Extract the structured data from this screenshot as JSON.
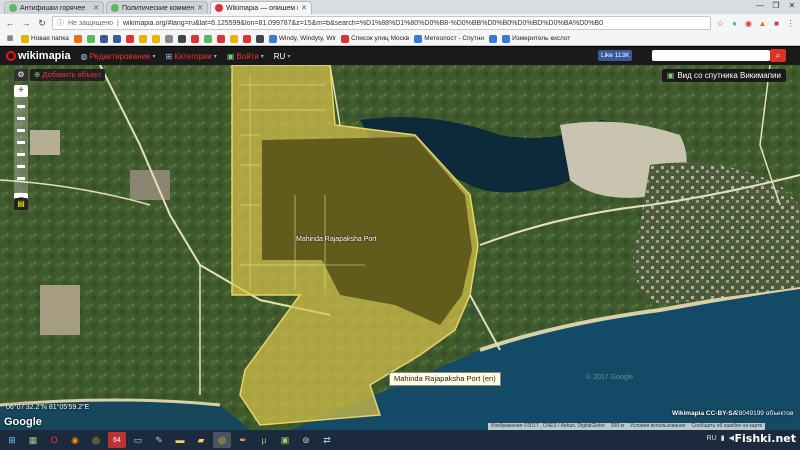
{
  "browser": {
    "tabs": [
      {
        "title": "Антифишки горячее",
        "favicon_color": "#5cb85c"
      },
      {
        "title": "Политические коммента",
        "favicon_color": "#5cb85c"
      },
      {
        "title": "Wikimapia — опишем в",
        "favicon_color": "#d33"
      }
    ],
    "security_label": "Не защищено",
    "url": "wikimapia.org/#lang=ru&lat=6.125599&lon=81.099787&z=15&m=b&search=%D1%88%D1%80%D0%B8-%D0%BB%D0%B0%D0%BD%D0%BA%D0%B0",
    "bookmarks": [
      {
        "label": "Новая папка",
        "color": "#e8b400"
      },
      {
        "label": "",
        "color": "#e96d0c"
      },
      {
        "label": "",
        "color": "#5cb85c"
      },
      {
        "label": "",
        "color": "#3b5998"
      },
      {
        "label": "",
        "color": "#3b5998"
      },
      {
        "label": "",
        "color": "#d33"
      },
      {
        "label": "",
        "color": "#e8b400"
      },
      {
        "label": "",
        "color": "#e8b400"
      },
      {
        "label": "",
        "color": "#888"
      },
      {
        "label": "",
        "color": "#444"
      },
      {
        "label": "",
        "color": "#d33"
      },
      {
        "label": "",
        "color": "#5cb85c"
      },
      {
        "label": "",
        "color": "#d33"
      },
      {
        "label": "",
        "color": "#e8b400"
      },
      {
        "label": "",
        "color": "#d33"
      },
      {
        "label": "",
        "color": "#444"
      },
      {
        "label": "Windy, Windyty, Wir",
        "color": "#3c78d8"
      },
      {
        "label": "Список улиц Москв",
        "color": "#d33"
      },
      {
        "label": "Метеопост - Спутни",
        "color": "#3c78d8"
      },
      {
        "label": "",
        "color": "#3c78d8"
      },
      {
        "label": "Измеритель кислот",
        "color": "#3c78d8"
      }
    ]
  },
  "header": {
    "logo": "wikimapia",
    "nav": [
      {
        "label": "Редактирование",
        "icon": "globe-icon"
      },
      {
        "label": "Категории",
        "icon": "tree-icon"
      },
      {
        "label": "Войти",
        "icon": "login-icon"
      }
    ],
    "language": "RU",
    "like_label": "Like 113K"
  },
  "map": {
    "add_object": "Добавить объект",
    "satellite_toggle": "Вид со спутника Викимапии",
    "place_label": "Mahinda Rajapaksha Port",
    "tooltip": "Mahinda Rajapaksha Port (en)",
    "coordinates": "06°07'32.2\"N 81°05'59.2\"E",
    "google": "Google",
    "license": "Wikimapia CC-BY-SA",
    "object_count": "28049199 объектов",
    "attribution": "Изображения ©2017 , CNES / Airbus, DigitalGlobe",
    "scale": "200 м",
    "terms": "Условия использования",
    "report": "Сообщить об ошибке на карте",
    "watermark": "© 2017 Google",
    "colors": {
      "port_fill": "#d8c24a",
      "port_dark": "#5a5418",
      "water": "#0d2a3a",
      "sea": "#134a66"
    }
  },
  "taskbar": {
    "apps": [
      "windows-logo",
      "files",
      "opera",
      "firefox",
      "chrome",
      "64",
      "terminal",
      "paint",
      "explorer",
      "folder",
      "chrome-active",
      "feather",
      "torrent",
      "game",
      "steam",
      "remote"
    ],
    "tray_lang": "RU",
    "site_watermark": "Fishki.net"
  }
}
